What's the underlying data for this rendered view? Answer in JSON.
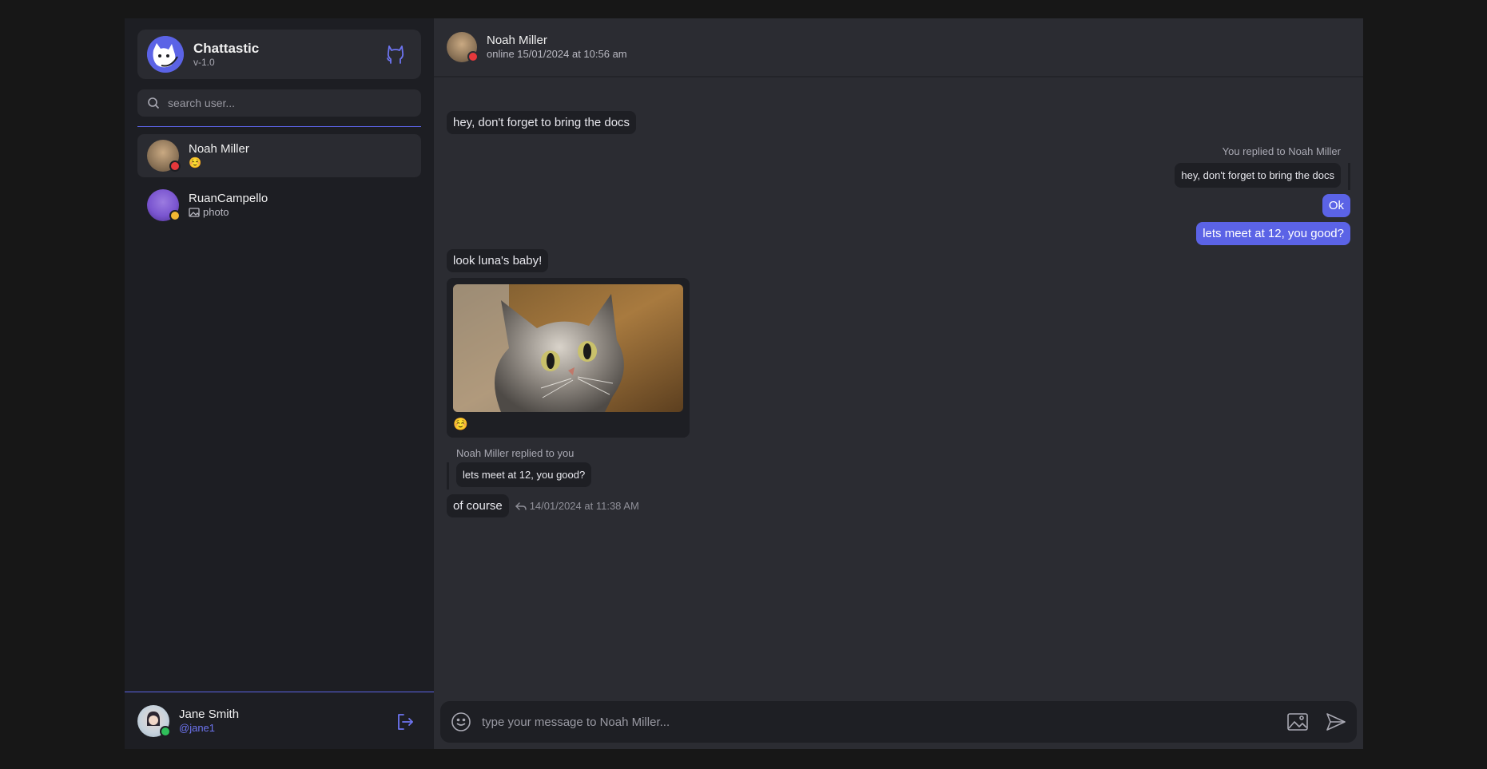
{
  "app": {
    "title": "Chattastic",
    "version": "v-1.0"
  },
  "search": {
    "placeholder": "search user..."
  },
  "contacts": [
    {
      "name": "Noah Miller",
      "preview": "☺️",
      "status_color": "#e5383b"
    },
    {
      "name": "RuanCampello",
      "preview": "photo",
      "status_color": "#f2b632"
    }
  ],
  "current_user": {
    "name": "Jane Smith",
    "handle": "@jane1",
    "status_color": "#2fbf5a"
  },
  "chat": {
    "contact_name": "Noah Miller",
    "contact_status": "online 15/01/2024 at 10:56 am",
    "composer_placeholder": "type your message to Noah Miller...",
    "messages": {
      "m1": "hey, don't forget to bring the docs",
      "reply_label_mine": "You replied to Noah Miller",
      "quoted_mine": "hey, don't forget to bring the docs",
      "m2": "Ok",
      "m3": "lets meet at 12, you good?",
      "m4": "look luna's baby!",
      "photo_caption": "☺️",
      "reply_label_theirs": "Noah Miller replied to you",
      "quoted_theirs": "lets meet at 12, you good?",
      "m5": "of course",
      "m5_time": "14/01/2024 at 11:38 AM"
    }
  },
  "colors": {
    "accent": "#5b63e6",
    "online_red": "#e5383b",
    "away_yellow": "#f2b632",
    "online_green": "#2fbf5a"
  }
}
